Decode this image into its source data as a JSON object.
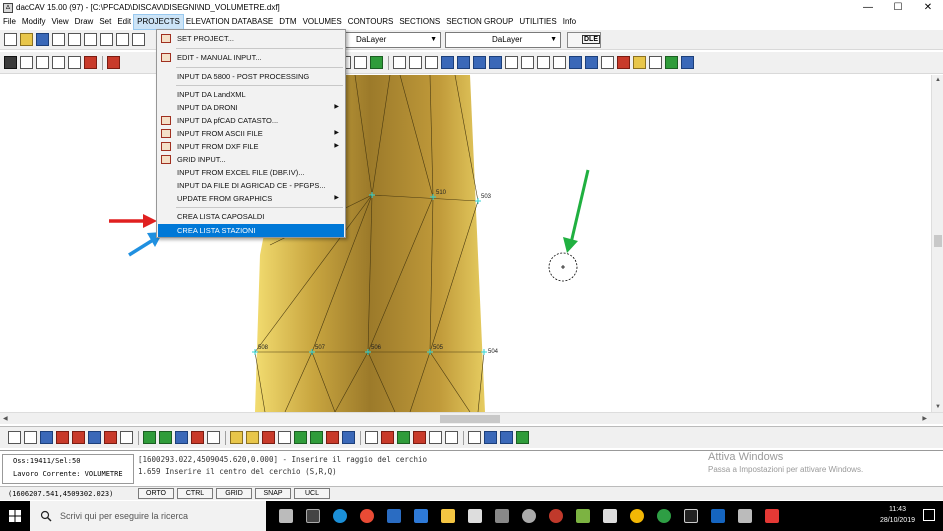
{
  "window": {
    "title": "dacCAV 15.00 (97) - [C:\\PFCAD\\DISCAV\\DISEGNI\\ND_VOLUMETRE.dxf]",
    "controls": [
      "—",
      "☐",
      "✕"
    ]
  },
  "menubar": {
    "items": [
      "File",
      "Modify",
      "View",
      "Draw",
      "Set",
      "Edit",
      "PROJECTS",
      "ELEVATION DATABASE",
      "DTM",
      "VOLUMES",
      "CONTOURS",
      "SECTIONS",
      "SECTION GROUP",
      "UTILITIES",
      "Info"
    ],
    "active_index": 6
  },
  "layer_combos": {
    "layer1": "DaLayer",
    "layer2": "DaLayer",
    "dle_label": "DLE"
  },
  "projects_menu": {
    "items": [
      {
        "label": "SET PROJECT...",
        "icon": true
      },
      {
        "label": "EDIT - MANUAL INPUT...",
        "icon": true
      },
      {
        "label": "INPUT DA 5800 - POST PROCESSING",
        "icon": false
      },
      {
        "label": "INPUT DA LandXML",
        "icon": false
      },
      {
        "label": "INPUT DA DRONI",
        "icon": false,
        "submenu": true
      },
      {
        "label": "INPUT DA pfCAD CATASTO...",
        "icon": true
      },
      {
        "label": "INPUT FROM ASCII FILE",
        "icon": true,
        "submenu": true
      },
      {
        "label": "INPUT FROM DXF FILE",
        "icon": true,
        "submenu": true
      },
      {
        "label": "GRID INPUT...",
        "icon": true
      },
      {
        "label": "INPUT FROM EXCEL FILE (DBF.IV)...",
        "icon": false
      },
      {
        "label": "INPUT DA FILE DI AGRICAD CE - PFGPS...",
        "icon": false
      },
      {
        "label": "UPDATE FROM GRAPHICS",
        "icon": false,
        "submenu": true
      },
      {
        "label": "CREA LISTA CAPOSALDI",
        "icon": false
      },
      {
        "label": "CREA LISTA STAZIONI",
        "icon": false,
        "highlighted": true
      }
    ]
  },
  "canvas": {
    "point_labels": [
      "510",
      "503",
      "508",
      "507",
      "506",
      "505",
      "504"
    ]
  },
  "command": {
    "coord_box": [
      "Oss:19411/Sel:50",
      "Lavoro Corrente: VOLUMETRE"
    ],
    "lines": [
      "[1600293.022,4509045.620,0.000] - Inserire il raggio del cerchio",
      "1.659   Inserire il centro del cerchio (S,R,Q)"
    ]
  },
  "watermark": {
    "title": "Attiva Windows",
    "subtitle": "Passa a Impostazioni per attivare Windows."
  },
  "statusbar": {
    "coords": "(1606207.541,4509302.023)",
    "modes": [
      "ORTO",
      "CTRL",
      "GRID",
      "SNAP",
      "UCL"
    ]
  },
  "taskbar": {
    "search_placeholder": "Scrivi qui per eseguire la ricerca",
    "time": "11:43",
    "date": "28/10/2019"
  },
  "colors": {
    "terrain_light": "#f0d060",
    "terrain_dark": "#8a6a20",
    "menu_highlight": "#0078d7",
    "arrow_red": "#e02020",
    "arrow_blue": "#2090e0",
    "arrow_green": "#20b040",
    "point_cyan": "#30d0d0"
  }
}
